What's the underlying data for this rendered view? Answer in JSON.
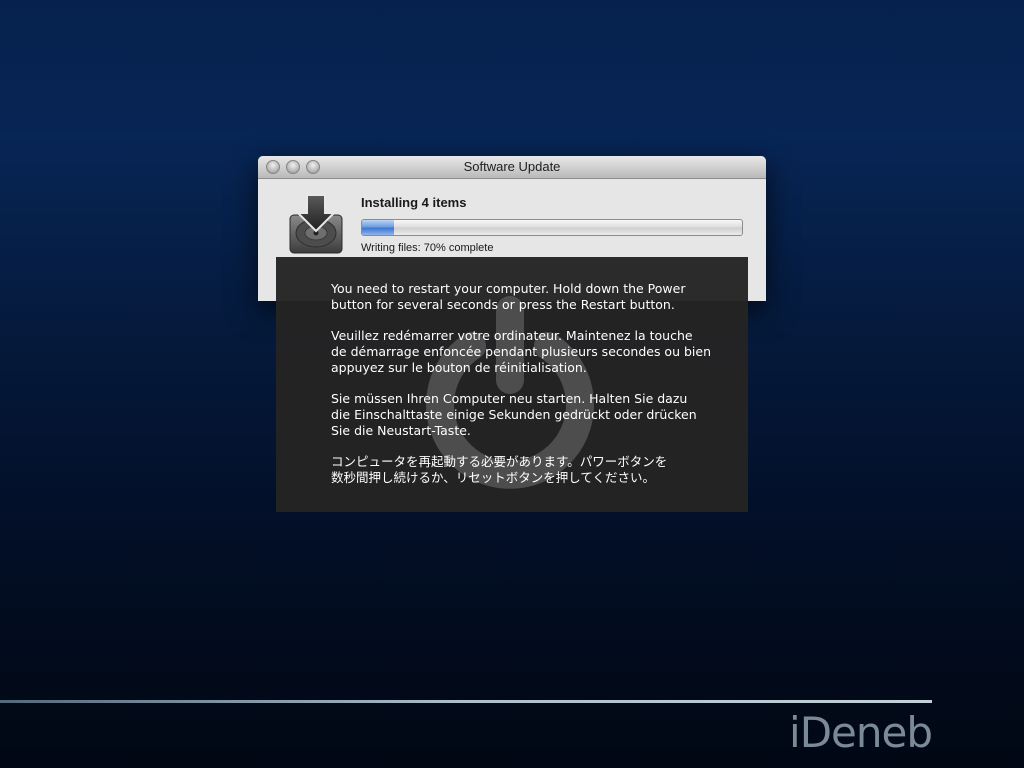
{
  "window": {
    "title": "Software Update",
    "controls": [
      "close-button",
      "minimize-button",
      "zoom-button"
    ],
    "icon": "hard-disk-download-icon",
    "installing_label": "Installing 4 items",
    "progress_percent": 70,
    "progress_status": "Writing files: 70% complete"
  },
  "panic_message": {
    "icon": "power-icon",
    "english": "You need to restart your computer. Hold down the Power\nbutton for several seconds or press the Restart button.",
    "french": "Veuillez redémarrer votre ordinateur. Maintenez la touche\nde démarrage enfoncée pendant plusieurs secondes ou bien\nappuyez sur le bouton de réinitialisation.",
    "german": "Sie müssen Ihren Computer neu starten. Halten Sie dazu\ndie Einschalttaste einige Sekunden gedrückt oder drücken\nSie die Neustart-Taste.",
    "japanese": "コンピュータを再起動する必要があります。パワーボタンを\n数秒間押し続けるか、リセットボタンを押してください。"
  },
  "branding": {
    "logo_text": "iDeneb"
  }
}
